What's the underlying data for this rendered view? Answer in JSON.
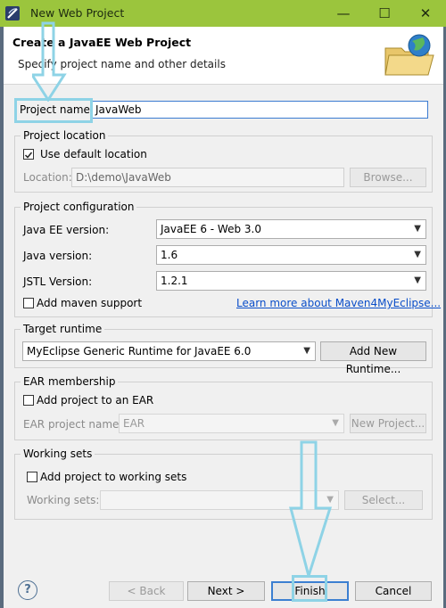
{
  "window": {
    "title": "New Web Project",
    "minimize": "—",
    "maximize": "☐",
    "close": "✕"
  },
  "header": {
    "title": "Create a JavaEE Web Project",
    "subtitle": "Specify project name and other details"
  },
  "project_name": {
    "label": "Project name:",
    "value": "JavaWeb"
  },
  "project_location": {
    "group": "Project location",
    "use_default": "Use default location",
    "location_label": "Location:",
    "location_value": "D:\\demo\\JavaWeb",
    "browse": "Browse..."
  },
  "project_configuration": {
    "group": "Project configuration",
    "javaee_label": "Java EE version:",
    "javaee_value": "JavaEE 6 - Web 3.0",
    "java_label": "Java version:",
    "java_value": "1.6",
    "jstl_label": "JSTL Version:",
    "jstl_value": "1.2.1",
    "maven": "Add maven support",
    "maven_link": "Learn more about Maven4MyEclipse..."
  },
  "target_runtime": {
    "group": "Target runtime",
    "value": "MyEclipse Generic Runtime for JavaEE 6.0",
    "add_button": "Add New Runtime..."
  },
  "ear": {
    "group": "EAR membership",
    "add": "Add project to an EAR",
    "name_label": "EAR project name:",
    "name_value": "EAR",
    "new_button": "New Project..."
  },
  "working_sets": {
    "group": "Working sets",
    "add": "Add project to working sets",
    "label": "Working sets:",
    "select_button": "Select..."
  },
  "footer": {
    "help": "?",
    "back": "< Back",
    "next": "Next >",
    "finish": "Finish",
    "cancel": "Cancel"
  },
  "colors": {
    "titlebar": "#9bc53d",
    "highlight": "#8ed3e6",
    "link": "#0a4ec9"
  }
}
